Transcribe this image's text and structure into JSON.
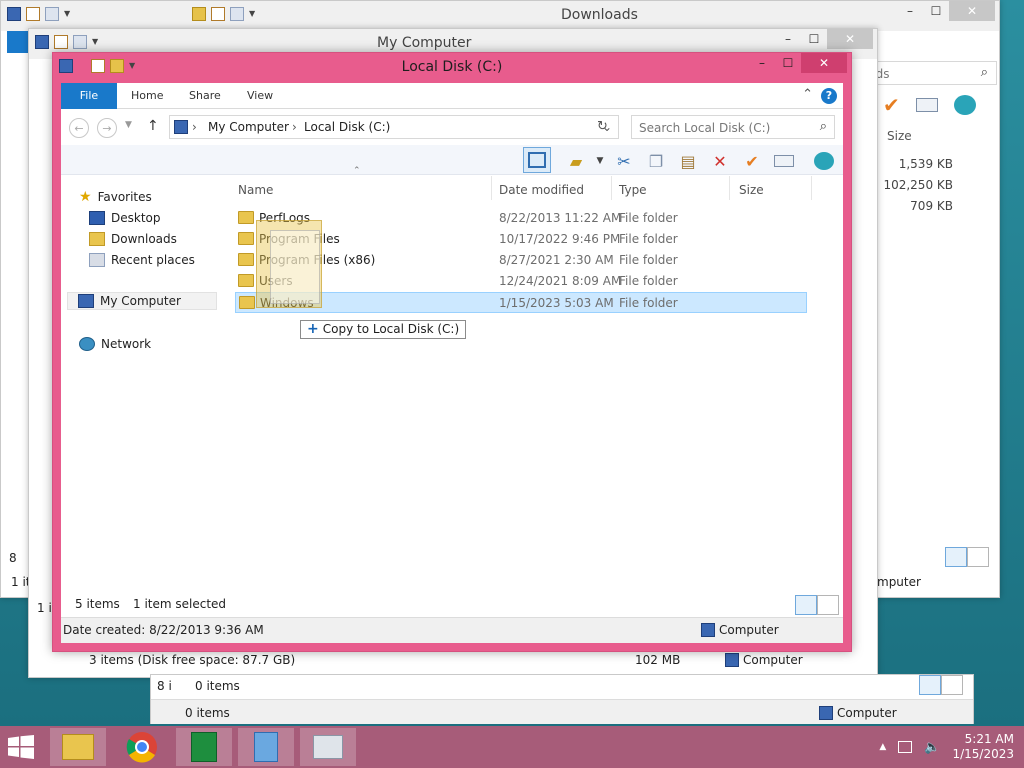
{
  "windows": {
    "downloads": {
      "title": "Downloads",
      "search_fragment": "nloads",
      "col_size": "Size",
      "sizes": [
        "1,539 KB",
        "102,250 KB",
        "709 KB"
      ],
      "status_left": "1 it",
      "status_right": "mputer",
      "left_count": "8"
    },
    "mycomputer": {
      "title": "My Computer",
      "status_text": "3 items (Disk free space: 87.7 GB)",
      "status_size": "102 MB",
      "status_location": "Computer",
      "left_count": "8",
      "left_status": "1 it"
    },
    "third": {
      "count_prefix": "8 i",
      "items_text": "0 items",
      "status_items": "0 items",
      "status_location": "Computer"
    }
  },
  "main": {
    "title": "Local Disk (C:)",
    "ribbon_tabs": [
      "File",
      "Home",
      "Share",
      "View"
    ],
    "address": {
      "segments": [
        "My Computer",
        "Local Disk (C:)"
      ]
    },
    "search_placeholder": "Search Local Disk (C:)",
    "nav": {
      "favorites": "Favorites",
      "desktop": "Desktop",
      "downloads": "Downloads",
      "recent": "Recent places",
      "mycomputer": "My Computer",
      "network": "Network"
    },
    "columns": {
      "name": "Name",
      "date": "Date modified",
      "type": "Type",
      "size": "Size"
    },
    "rows": [
      {
        "name": "PerfLogs",
        "date": "8/22/2013 11:22 AM",
        "type": "File folder",
        "selected": false
      },
      {
        "name": "Program Files",
        "date": "10/17/2022 9:46 PM",
        "type": "File folder",
        "selected": false
      },
      {
        "name": "Program Files (x86)",
        "date": "8/27/2021 2:30 AM",
        "type": "File folder",
        "selected": false
      },
      {
        "name": "Users",
        "date": "12/24/2021 8:09 AM",
        "type": "File folder",
        "selected": false
      },
      {
        "name": "Windows",
        "date": "1/15/2023 5:03 AM",
        "type": "File folder",
        "selected": true
      }
    ],
    "drag_tooltip": "Copy to Local Disk (C:)",
    "item_count": "5 items",
    "selected_count": "1 item selected",
    "details": "Date created: 8/22/2013 9:36 AM",
    "details_location": "Computer"
  },
  "taskbar": {
    "time": "5:21 AM",
    "date": "1/15/2023"
  },
  "colors": {
    "accent_window": "#e85c8d",
    "file_tab": "#1979ca",
    "taskbar": "#a75c79",
    "selection": "#cce8ff"
  }
}
